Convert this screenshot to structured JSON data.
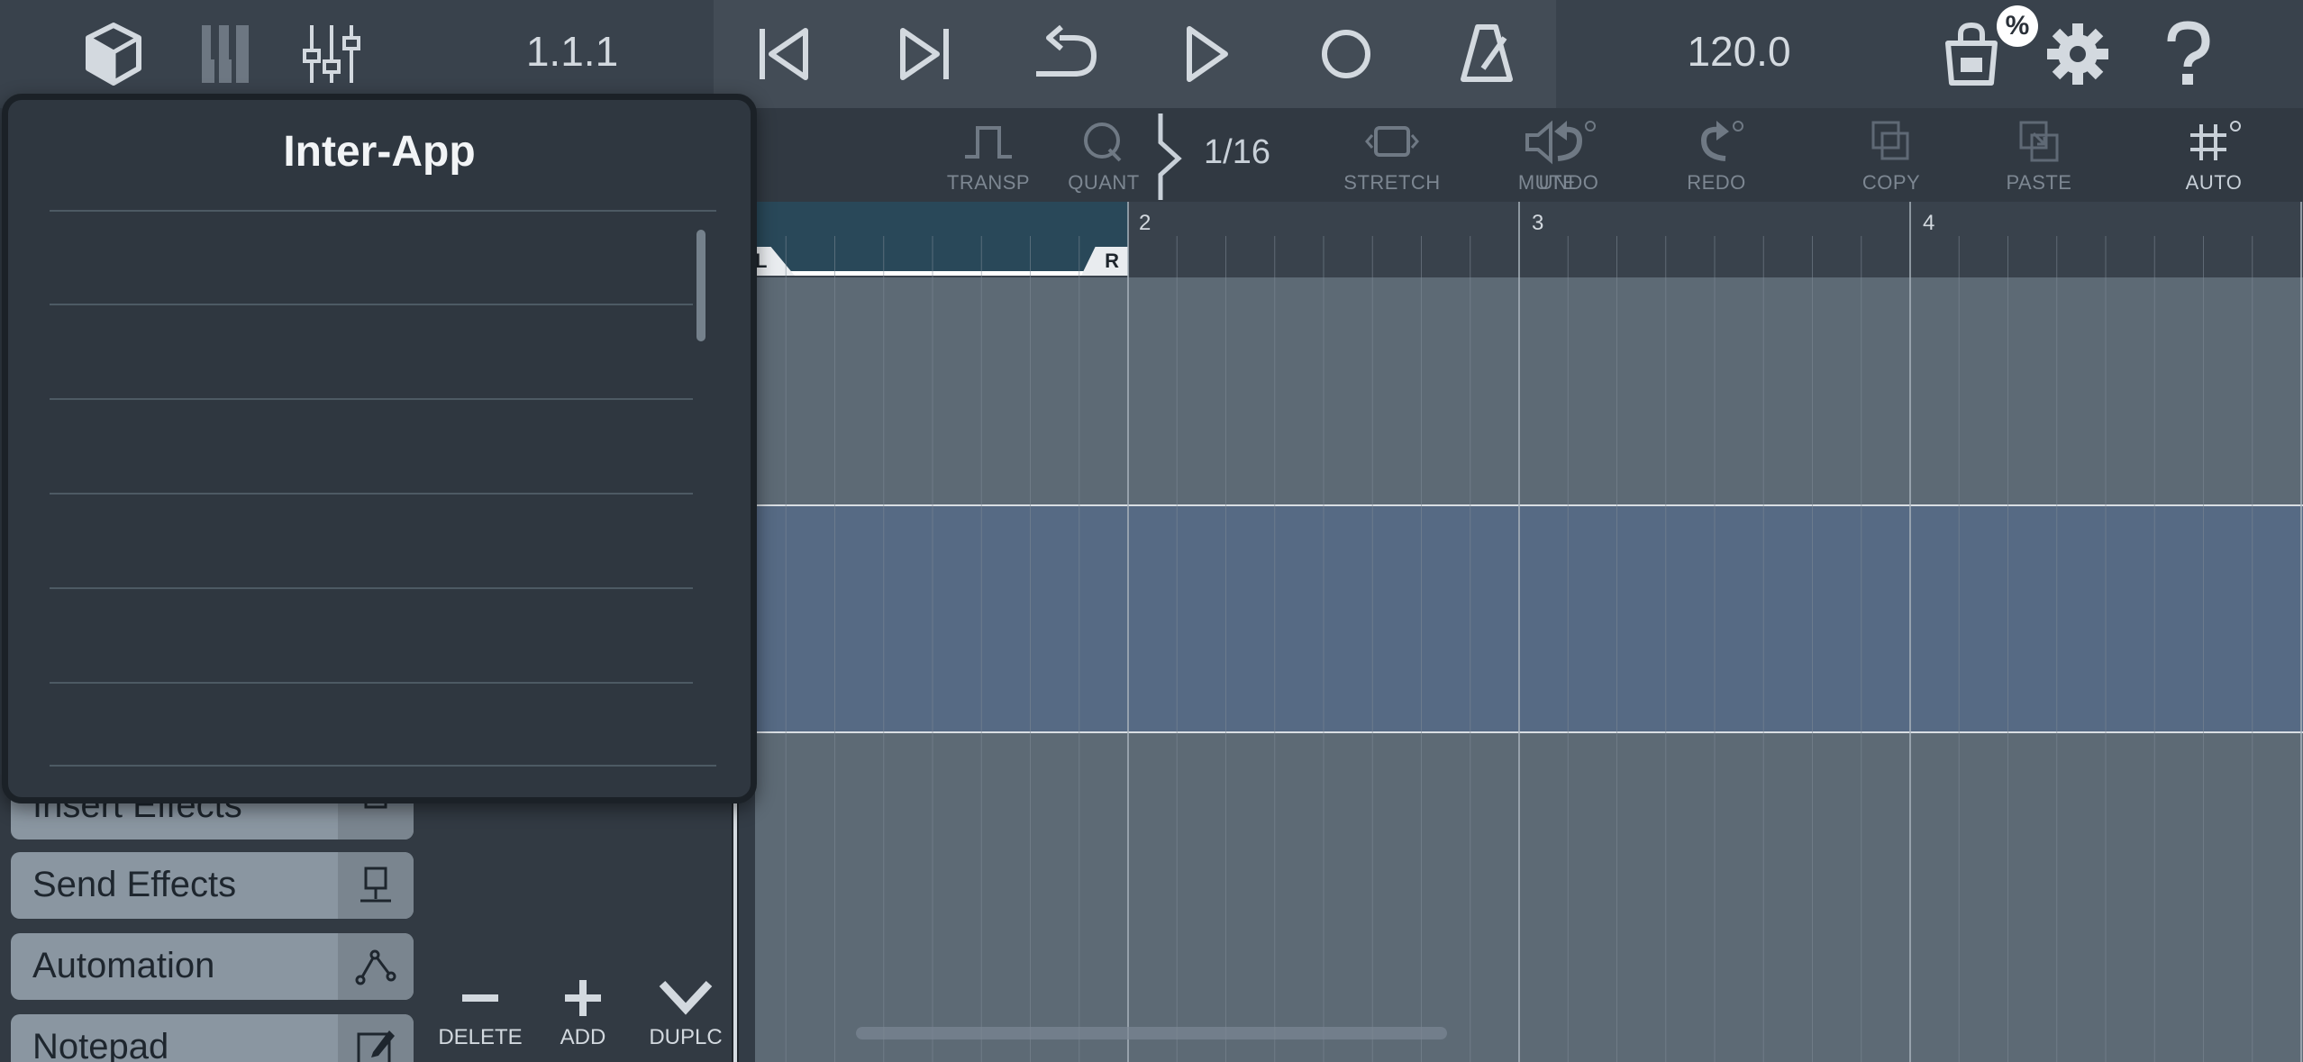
{
  "topbar": {
    "position": "1.1.1",
    "tempo": "120.0",
    "store_badge": "%",
    "icons": [
      "cube-icon",
      "piano-keys-icon",
      "mixer-icon",
      "skip-start-icon",
      "skip-end-icon",
      "loop-icon",
      "play-icon",
      "record-icon",
      "metronome-icon",
      "store-bag-icon",
      "gear-icon",
      "help-icon"
    ]
  },
  "edit_toolbar": {
    "mute": "MUTE",
    "transp": "TRANSP",
    "quant": "QUANT",
    "quant_value": "1/16",
    "stretch": "STRETCH",
    "undo": "UNDO",
    "redo": "REDO",
    "copy": "COPY",
    "paste": "PASTE",
    "auto": "AUTO"
  },
  "ruler": {
    "bar_2": "2",
    "bar_3": "3",
    "bar_4": "4",
    "loop_left": "L",
    "loop_right": "R"
  },
  "side_panel": {
    "items": [
      {
        "label": "Insert Effects"
      },
      {
        "label": "Send Effects"
      },
      {
        "label": "Automation"
      },
      {
        "label": "Notepad"
      }
    ]
  },
  "track_tools": {
    "delete": "DELETE",
    "add": "ADD",
    "duplicate": "DUPLC"
  },
  "popover": {
    "title": "Inter-App"
  },
  "colors": {
    "track_selected": "#566a84",
    "track_default": "#5d6a75",
    "loop_region": "#294859"
  }
}
